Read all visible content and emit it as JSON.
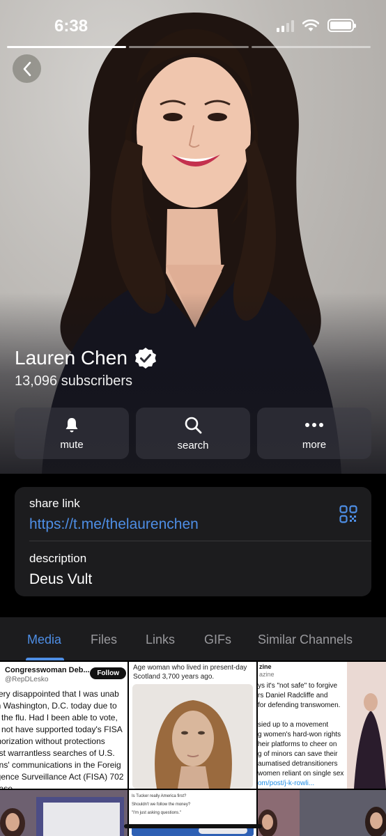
{
  "status_bar": {
    "time": "6:38"
  },
  "profile": {
    "name": "Lauren Chen",
    "subscribers": "13,096 subscribers",
    "verified_icon": "verified-badge-icon"
  },
  "actions": [
    {
      "label": "mute",
      "icon": "bell-icon"
    },
    {
      "label": "search",
      "icon": "search-icon"
    },
    {
      "label": "more",
      "icon": "more-dots-icon"
    }
  ],
  "info": {
    "share_link_label": "share link",
    "share_link": "https://t.me/thelaurenchen",
    "description_label": "description",
    "description": "Deus Vult"
  },
  "tabs": [
    "Media",
    "Files",
    "Links",
    "GIFs",
    "Similar Channels"
  ],
  "active_tab": "Media",
  "colors": {
    "accent": "#4e8ee5",
    "card": "#1c1c1e",
    "background": "#000000"
  },
  "media": {
    "tile1": {
      "author": "Congresswoman Deb...",
      "handle": "@RepDLesko",
      "follow": "Follow",
      "lines": [
        "very disappointed that I was unab",
        "in Washington, D.C. today due to",
        "g the flu. Had I been able to vote,",
        "d not have supported today's FISA",
        "thorization without protections",
        "nst warrantless searches of U.S.",
        "ens' communications in the Foreig",
        "igence Surveillance Act (FISA) 702",
        "base."
      ]
    },
    "tile2": {
      "caption": "Age woman who lived in present-day Scotland 3,700 years ago."
    },
    "tile3": {
      "author": "zine",
      "handle": "azine",
      "lines": [
        "ys it's \"not safe\" to forgive",
        "rs Daniel Radcliffe and",
        "for defending transwomen.",
        "",
        "sied up to a movement",
        "g women's hard-won rights",
        "heir platforms to cheer on",
        "g of minors can save their",
        "aumatised detransitioners",
        "women reliant on single sex"
      ],
      "link": "om/post/j-k-rowli..."
    },
    "tile5": {
      "lines": [
        "Is Tucker really America first?",
        "Shouldn't we follow the money?",
        "\"I'm just asking questions.\""
      ]
    }
  }
}
